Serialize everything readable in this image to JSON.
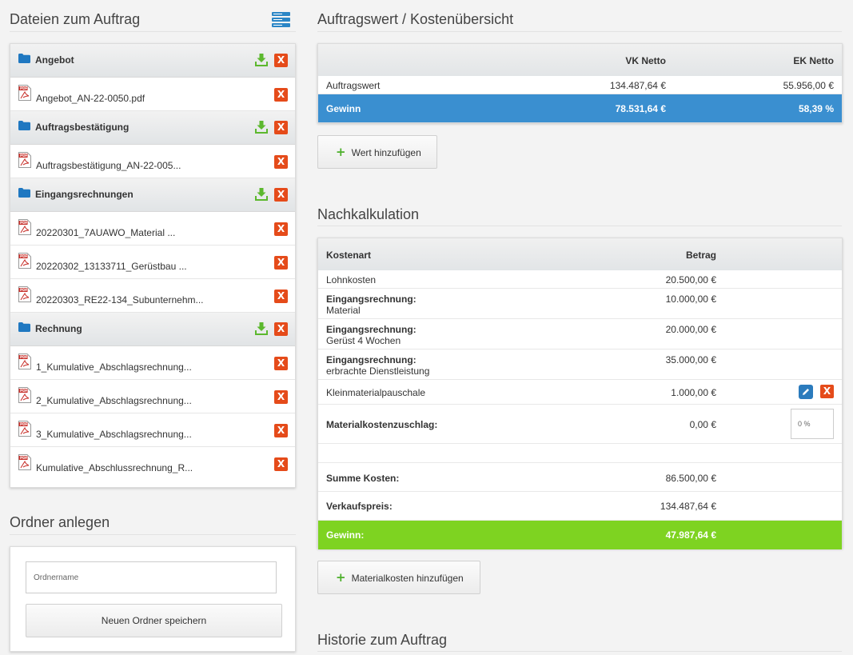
{
  "left": {
    "files_title": "Dateien zum Auftrag",
    "folders": [
      {
        "name": "Angebot",
        "files": [
          "Angebot_AN-22-0050.pdf"
        ]
      },
      {
        "name": "Auftragsbestätigung",
        "files": [
          "Auftragsbestätigung_AN-22-005..."
        ]
      },
      {
        "name": "Eingangsrechnungen",
        "files": [
          "20220301_7AUAWO_Material ...",
          "20220302_13133711_Gerüstbau ...",
          "20220303_RE22-134_Subunternehm..."
        ]
      },
      {
        "name": "Rechnung",
        "files": [
          "1_Kumulative_Abschlagsrechnung...",
          "2_Kumulative_Abschlagsrechnung...",
          "3_Kumulative_Abschlagsrechnung...",
          "Kumulative_Abschlussrechnung_R..."
        ]
      }
    ],
    "delete_glyph": "X",
    "new_folder_title": "Ordner anlegen",
    "new_folder_placeholder": "Ordnername",
    "new_folder_button": "Neuen Ordner speichern"
  },
  "summary": {
    "title": "Auftragswert / Kostenübersicht",
    "col_vk": "VK Netto",
    "col_ek": "EK Netto",
    "rows": [
      {
        "label": "Auftragswert",
        "vk": "134.487,64 €",
        "ek": "55.956,00 €"
      }
    ],
    "gain": {
      "label": "Gewinn",
      "vk": "78.531,64 €",
      "ek": "58,39 %"
    },
    "add_button": "Wert hinzufügen"
  },
  "calc": {
    "title": "Nachkalkulation",
    "col_type": "Kostenart",
    "col_amount": "Betrag",
    "lohn": {
      "label": "Lohnkosten",
      "amount": "20.500,00 €"
    },
    "eingang": [
      {
        "label": "Eingangsrechnung:",
        "sub": "Material",
        "amount": "10.000,00 €"
      },
      {
        "label": "Eingangsrechnung:",
        "sub": "Gerüst 4 Wochen",
        "amount": "20.000,00 €"
      },
      {
        "label": "Eingangsrechnung:",
        "sub": "erbrachte Dienstleistung",
        "amount": "35.000,00 €"
      }
    ],
    "klein": {
      "label": "Kleinmaterialpauschale",
      "amount": "1.000,00 €"
    },
    "zuschlag": {
      "label": "Materialkostenzuschlag:",
      "amount": "0,00 €",
      "percent_placeholder": "0 %"
    },
    "summe": {
      "label": "Summe Kosten:",
      "amount": "86.500,00 €"
    },
    "verkauf": {
      "label": "Verkaufspreis:",
      "amount": "134.487,64 €"
    },
    "gain": {
      "label": "Gewinn:",
      "amount": "47.987,64 €"
    },
    "add_button": "Materialkosten hinzufügen"
  },
  "history": {
    "title": "Historie zum Auftrag"
  },
  "colors": {
    "accent_blue": "#3a8fd0",
    "accent_green": "#7ed321",
    "delete_red": "#e54b1a",
    "download_green": "#5cb82e"
  }
}
